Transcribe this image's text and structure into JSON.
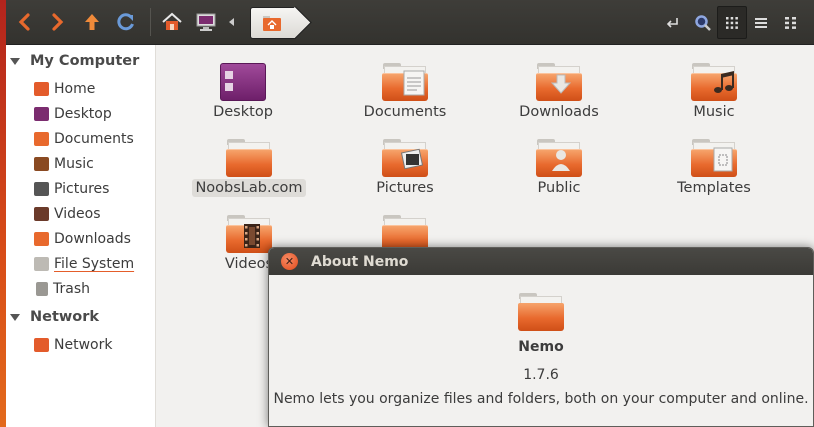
{
  "sidebar": {
    "sections": [
      {
        "title": "My Computer",
        "items": [
          {
            "label": "Home",
            "icon": "home-icon"
          },
          {
            "label": "Desktop",
            "icon": "desktop-icon"
          },
          {
            "label": "Documents",
            "icon": "documents-icon"
          },
          {
            "label": "Music",
            "icon": "music-icon"
          },
          {
            "label": "Pictures",
            "icon": "pictures-icon"
          },
          {
            "label": "Videos",
            "icon": "videos-icon"
          },
          {
            "label": "Downloads",
            "icon": "downloads-icon"
          },
          {
            "label": "File System",
            "icon": "drive-icon"
          },
          {
            "label": "Trash",
            "icon": "trash-icon"
          }
        ]
      },
      {
        "title": "Network",
        "items": [
          {
            "label": "Network",
            "icon": "network-icon"
          }
        ]
      }
    ]
  },
  "main": {
    "items": [
      {
        "label": "Desktop",
        "icon": "desktop-folder-icon"
      },
      {
        "label": "Documents",
        "icon": "documents-folder-icon"
      },
      {
        "label": "Downloads",
        "icon": "downloads-folder-icon"
      },
      {
        "label": "Music",
        "icon": "music-folder-icon"
      },
      {
        "label": "NoobsLab.com",
        "icon": "folder-icon"
      },
      {
        "label": "Pictures",
        "icon": "pictures-folder-icon"
      },
      {
        "label": "Public",
        "icon": "public-folder-icon"
      },
      {
        "label": "Templates",
        "icon": "templates-folder-icon"
      },
      {
        "label": "Videos",
        "icon": "videos-folder-icon"
      },
      {
        "label": "",
        "icon": "folder-icon"
      }
    ]
  },
  "dialog": {
    "title": "About Nemo",
    "app_name": "Nemo",
    "version": "1.7.6",
    "description": "Nemo lets you organize files and folders, both on your computer and online."
  },
  "colors": {
    "accent": "#e8692d",
    "toolbar": "#3a3935",
    "dialog_title": "#3b3a36"
  }
}
